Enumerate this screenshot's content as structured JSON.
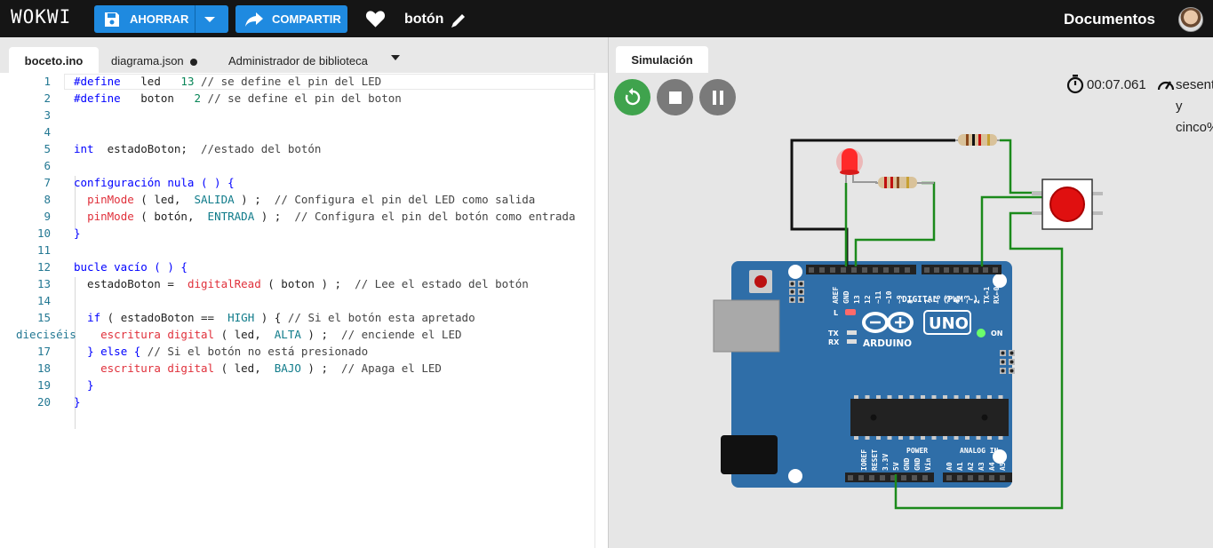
{
  "header": {
    "logo": "WOKWI",
    "save_label": "AHORRAR",
    "share_label": "COMPARTIR",
    "project_name": "botón",
    "docs_label": "Documentos"
  },
  "editor": {
    "tabs": [
      {
        "label": "boceto.ino"
      },
      {
        "label": "diagrama.json"
      },
      {
        "label": "Administrador de biblioteca"
      }
    ],
    "line_numbers": [
      "1",
      "2",
      "3",
      "4",
      "5",
      "6",
      "7",
      "8",
      "9",
      "10",
      "11",
      "12",
      "13",
      "14",
      "15",
      "dieciséis",
      "17",
      "18",
      "19",
      "20"
    ],
    "lines": [
      [
        {
          "t": "#define",
          "c": "kw"
        },
        {
          "t": "   led   "
        },
        {
          "t": "13",
          "c": "num"
        },
        {
          "t": " // se define el pin del LED",
          "c": "cm"
        }
      ],
      [
        {
          "t": "#define",
          "c": "kw"
        },
        {
          "t": "   boton   "
        },
        {
          "t": "2",
          "c": "num"
        },
        {
          "t": " // se define el pin del boton",
          "c": "cm"
        }
      ],
      [],
      [],
      [
        {
          "t": "int",
          "c": "kw"
        },
        {
          "t": "  estadoBoton;  "
        },
        {
          "t": "//estado del botón",
          "c": "cm"
        }
      ],
      [],
      [
        {
          "t": "configuración nula ( ) {",
          "c": "kw"
        }
      ],
      [
        {
          "t": "  "
        },
        {
          "t": "pinMode",
          "c": "fn"
        },
        {
          "t": " ( led,  "
        },
        {
          "t": "SALIDA",
          "c": "ct"
        },
        {
          "t": " ) ;  "
        },
        {
          "t": "// Configura el pin del LED como salida",
          "c": "cm"
        }
      ],
      [
        {
          "t": "  "
        },
        {
          "t": "pinMode",
          "c": "fn"
        },
        {
          "t": " ( botón,  "
        },
        {
          "t": "ENTRADA",
          "c": "ct"
        },
        {
          "t": " ) ;  "
        },
        {
          "t": "// Configura el pin del botón como entrada",
          "c": "cm"
        }
      ],
      [
        {
          "t": "}",
          "c": "kw"
        }
      ],
      [],
      [
        {
          "t": "bucle vacío ( ) {",
          "c": "kw"
        }
      ],
      [
        {
          "t": "  estadoBoton =  "
        },
        {
          "t": "digitalRead",
          "c": "fn"
        },
        {
          "t": " ( boton ) ;  "
        },
        {
          "t": "// Lee el estado del botón",
          "c": "cm"
        }
      ],
      [],
      [
        {
          "t": "  "
        },
        {
          "t": "if",
          "c": "kw"
        },
        {
          "t": " ( estadoBoton ==  "
        },
        {
          "t": "HIGH",
          "c": "ct"
        },
        {
          "t": " ) { "
        },
        {
          "t": "// Si el botón esta apretado",
          "c": "cm"
        }
      ],
      [
        {
          "t": "    "
        },
        {
          "t": "escritura digital",
          "c": "fn"
        },
        {
          "t": " ( led,  "
        },
        {
          "t": "ALTA",
          "c": "ct"
        },
        {
          "t": " ) ;  "
        },
        {
          "t": "// enciende el LED",
          "c": "cm"
        }
      ],
      [
        {
          "t": "  "
        },
        {
          "t": "} else {",
          "c": "kw"
        },
        {
          "t": " // Si el botón no está presionado",
          "c": "cm"
        }
      ],
      [
        {
          "t": "    "
        },
        {
          "t": "escritura digital",
          "c": "fn"
        },
        {
          "t": " ( led,  "
        },
        {
          "t": "BAJO",
          "c": "ct"
        },
        {
          "t": " ) ;  "
        },
        {
          "t": "// Apaga el LED",
          "c": "cm"
        }
      ],
      [
        {
          "t": "  }",
          "c": "kw"
        }
      ],
      [
        {
          "t": "}",
          "c": "kw"
        }
      ]
    ]
  },
  "simulation": {
    "tab_label": "Simulación",
    "timer": "00:07.061",
    "speed_text": "sesenta y cinco%",
    "board": {
      "brand": "ARDUINO",
      "model": "UNO",
      "digital_label": "DIGITAL (PWM ~)",
      "on_label": "ON",
      "l_label": "L",
      "tx_label": "TX",
      "rx_label": "RX",
      "power_label": "POWER",
      "analog_label": "ANALOG IN",
      "top_pins": [
        "AREF",
        "GND",
        "13",
        "12",
        "~11",
        "~10",
        "~9",
        "8",
        "7",
        "~6",
        "~5",
        "4",
        "~3",
        "2",
        "TX→1",
        "RX←0"
      ],
      "power_pins": [
        "IOREF",
        "RESET",
        "3.3V",
        "5V",
        "GND",
        "GND",
        "Vin"
      ],
      "analog_pins": [
        "A0",
        "A1",
        "A2",
        "A3",
        "A4",
        "A5"
      ]
    },
    "colors": {
      "board": "#2f6ea8",
      "wire_black": "#111111",
      "wire_green": "#1b8a1b",
      "led_red": "#ff2020",
      "button_red": "#e01010",
      "restart": "#3fa34d"
    }
  }
}
